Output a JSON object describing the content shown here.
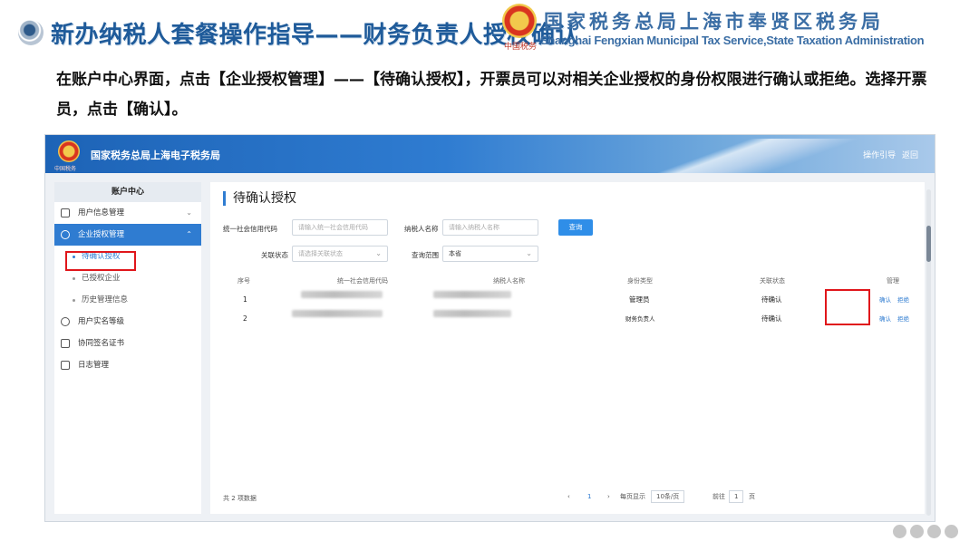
{
  "slide": {
    "title": "新办纳税人套餐操作指导——财务负责人授权确认",
    "org_cn": "国家税务总局上海市奉贤区税务局",
    "org_en": "Shanghai Fengxian Municipal Tax Service,State Taxation Administration",
    "emblem_caption": "中国税务",
    "instruction": "在账户中心界面，点击【企业授权管理】——【待确认授权】，开票员可以对相关企业授权的身份权限进行确认或拒绝。选择开票员，点击【确认】。",
    "accent_color": "#1f5b9a",
    "highlight_color": "#e0161b"
  },
  "app": {
    "title": "国家税务总局上海电子税务局",
    "logo_caption": "中国税务",
    "header_links": [
      "操作引导",
      "返回"
    ],
    "sidebar": {
      "heading": "账户中心",
      "items": [
        {
          "label": "用户信息管理",
          "icon": "id-card-icon",
          "expandable": true
        },
        {
          "label": "企业授权管理",
          "icon": "authorization-icon",
          "expandable": true,
          "expanded": true
        },
        {
          "label": "待确认授权",
          "sub": true,
          "current": true
        },
        {
          "label": "已授权企业",
          "sub": true
        },
        {
          "label": "历史管理信息",
          "sub": true
        },
        {
          "label": "用户实名等级",
          "icon": "user-icon"
        },
        {
          "label": "协同签名证书",
          "icon": "certificate-icon"
        },
        {
          "label": "日志管理",
          "icon": "log-icon"
        }
      ]
    },
    "main": {
      "title": "待确认授权",
      "filters": {
        "credit_code_label": "统一社会信用代码",
        "credit_code_placeholder": "请输入统一社会信用代码",
        "taxpayer_name_label": "纳税人名称",
        "taxpayer_name_placeholder": "请输入纳税人名称",
        "query_button": "查询",
        "relation_label": "关联状态",
        "relation_placeholder": "请选择关联状态",
        "scope_label": "查询范围",
        "scope_value": "本省"
      },
      "table": {
        "headers": [
          "序号",
          "统一社会信用代码",
          "纳税人名称",
          "身份类型",
          "关联状态",
          "管理"
        ],
        "rows": [
          {
            "index": "1",
            "identity": "管理员",
            "status": "待确认",
            "actions": [
              "确认",
              "拒绝"
            ]
          },
          {
            "index": "2",
            "identity": "财务负责人",
            "status": "待确认",
            "actions": [
              "确认",
              "拒绝"
            ]
          }
        ]
      },
      "footer": {
        "total": "共 2 项数据",
        "prev": "‹",
        "page": "1",
        "next": "›",
        "per_page_label": "每页显示",
        "per_page_value": "10条/页",
        "goto_label": "前往",
        "goto_value": "1",
        "goto_suffix": "页"
      }
    }
  }
}
